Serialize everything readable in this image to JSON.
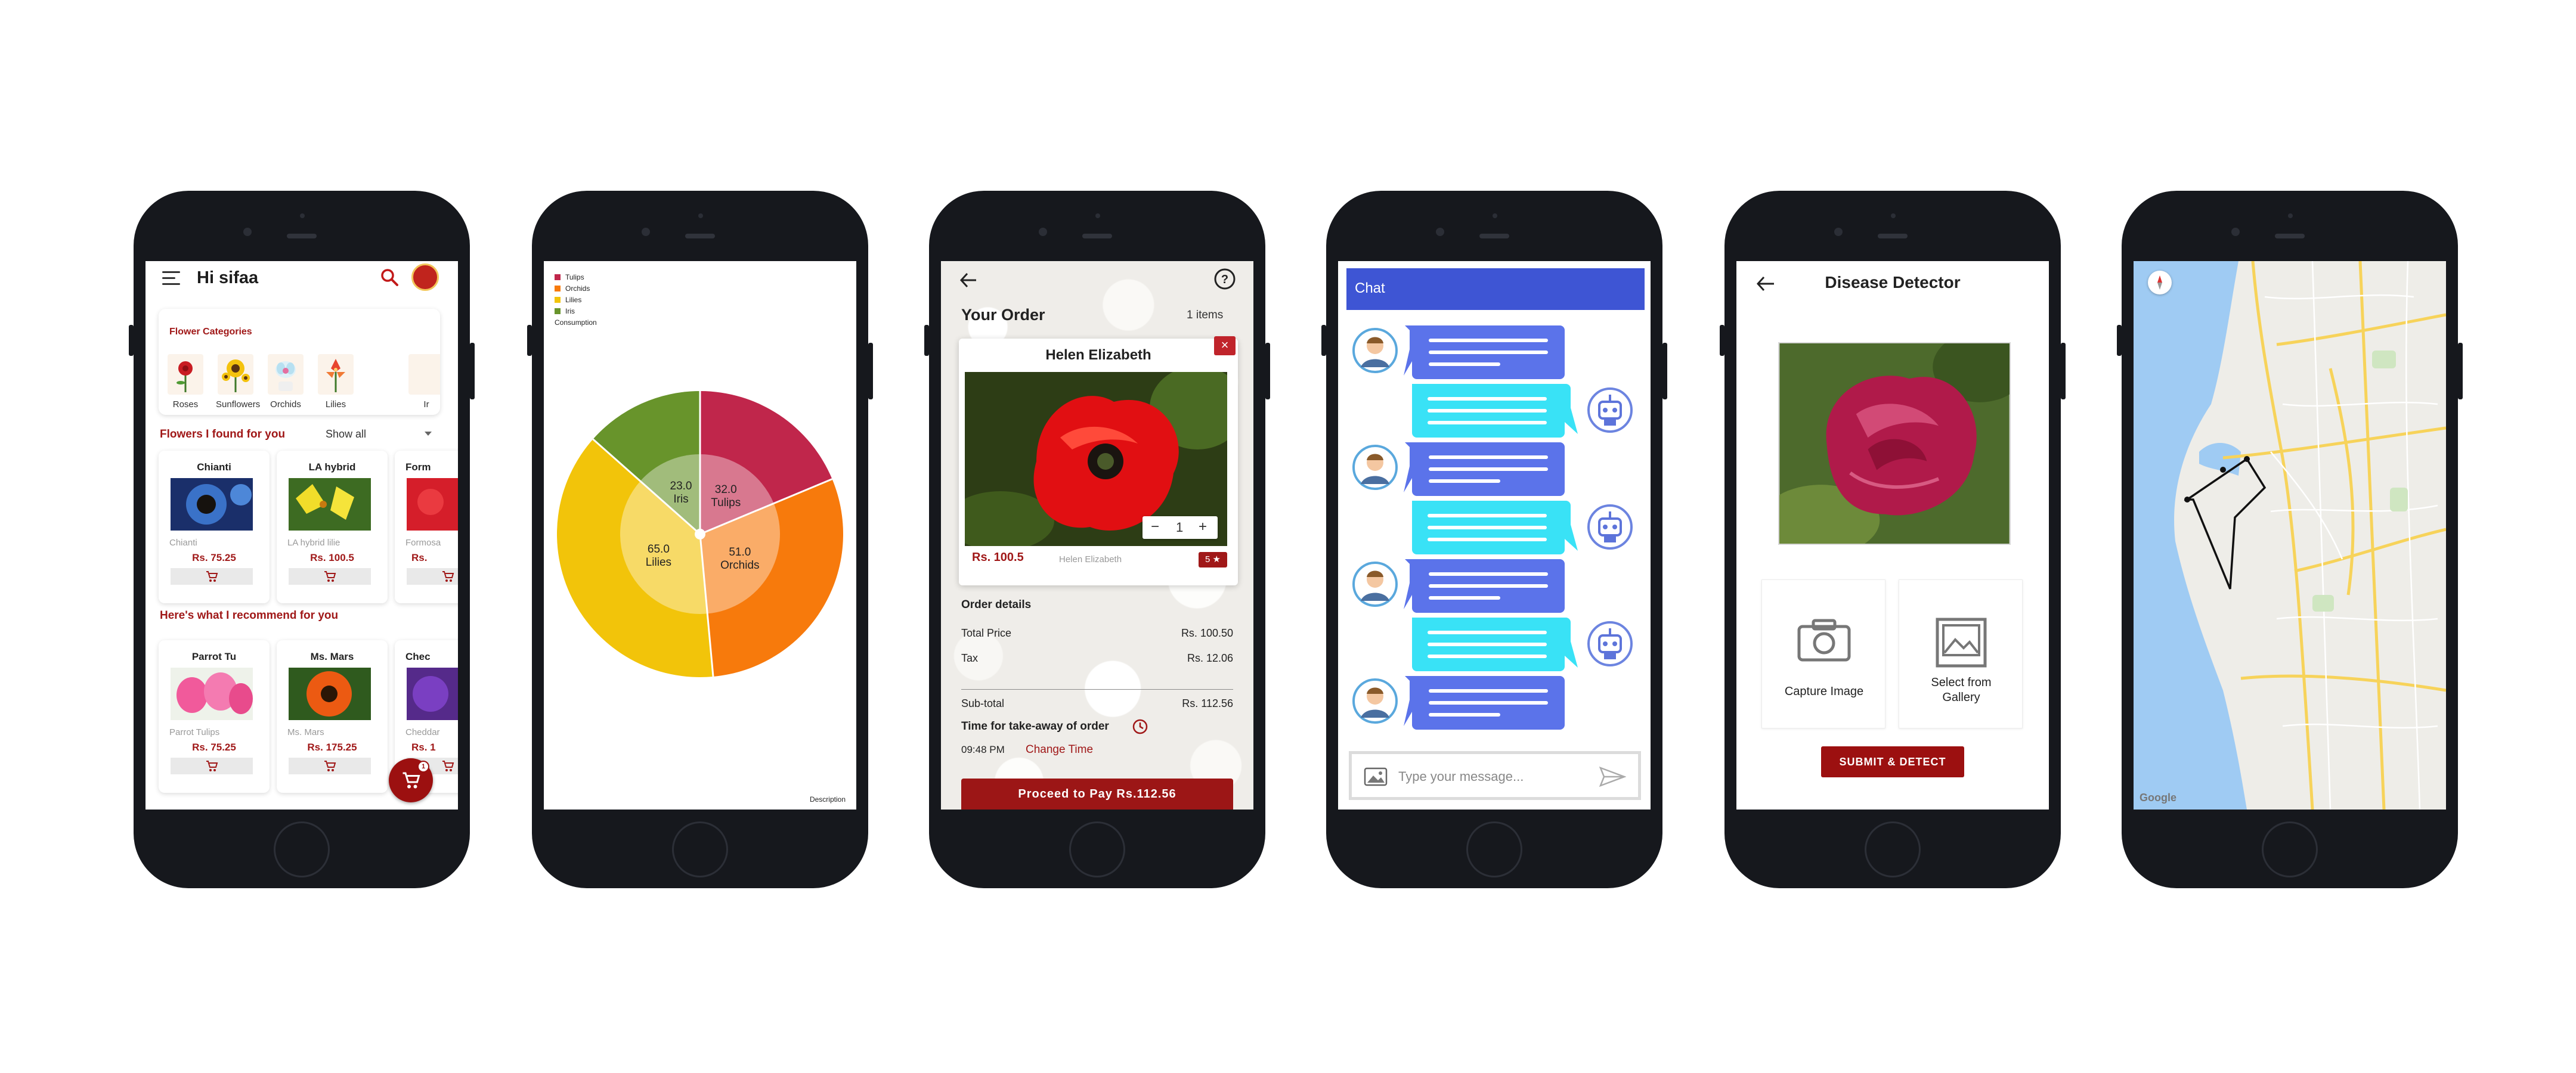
{
  "home": {
    "greeting": "Hi sifaa",
    "categories_title": "Flower Categories",
    "categories": [
      {
        "label": "Roses"
      },
      {
        "label": "Sunflowers"
      },
      {
        "label": "Orchids"
      },
      {
        "label": "Lilies"
      },
      {
        "label": "Ir"
      }
    ],
    "found_title": "Flowers I found for you",
    "show_all": "Show all",
    "found_products": [
      {
        "name": "Chianti",
        "sub": "Chianti",
        "price": "Rs. 75.25"
      },
      {
        "name": "LA hybrid",
        "sub": "LA hybrid lilie",
        "price": "Rs. 100.5"
      },
      {
        "name": "Form",
        "sub": "Formosa",
        "price": "Rs."
      }
    ],
    "recommend_title": "Here's what I recommend for you",
    "recommended_products": [
      {
        "name": "Parrot Tu",
        "sub": "Parrot Tulips",
        "price": "Rs. 75.25"
      },
      {
        "name": "Ms. Mars",
        "sub": "Ms. Mars",
        "price": "Rs. 175.25"
      },
      {
        "name": "Chec",
        "sub": "Cheddar",
        "price": "Rs. 1"
      }
    ],
    "cart_badge": "1",
    "colors": {
      "accent": "#a01818"
    }
  },
  "chart_data": {
    "type": "pie",
    "legend": [
      "Tulips",
      "Orchids",
      "Lilies",
      "Iris"
    ],
    "legend_extra": "Consumption",
    "legend_position": "top-left",
    "description": "Description",
    "series": [
      {
        "name": "Tulips",
        "value": 32.0,
        "color": "#c0264b"
      },
      {
        "name": "Orchids",
        "value": 51.0,
        "color": "#f77a0c"
      },
      {
        "name": "Lilies",
        "value": 65.0,
        "color": "#f2c40a"
      },
      {
        "name": "Iris",
        "value": 23.0,
        "color": "#68942b"
      }
    ],
    "value_labels": [
      "32.0",
      "51.0",
      "65.0",
      "23.0"
    ]
  },
  "order": {
    "title": "Your Order",
    "items_count": "1 items",
    "seller_name": "Helen Elizabeth",
    "quantity": "1",
    "price": "Rs. 100.5",
    "seller_small": "Helen Elizabeth",
    "rating": "5 ★",
    "details_title": "Order details",
    "rows": [
      {
        "label": "Total Price",
        "value": "Rs. 100.50"
      },
      {
        "label": "Tax",
        "value": "Rs. 12.06"
      },
      {
        "label": "Sub-total",
        "value": "Rs. 112.56"
      }
    ],
    "time_title": "Time for take-away of order",
    "time_value": "09:48 PM",
    "change_time": "Change Time",
    "pay_button": "Proceed to Pay Rs.112.56"
  },
  "chat": {
    "title": "Chat",
    "input_placeholder": "Type your message...",
    "colors": {
      "bar": "#3e55d4",
      "user_bubble": "#5b73ea",
      "bot_bubble": "#39e2f6"
    }
  },
  "disease": {
    "title": "Disease Detector",
    "capture_label": "Capture Image",
    "gallery_label": "Select from Gallery",
    "submit_label": "SUBMIT & DETECT"
  },
  "map": {
    "google_label": "Google"
  }
}
